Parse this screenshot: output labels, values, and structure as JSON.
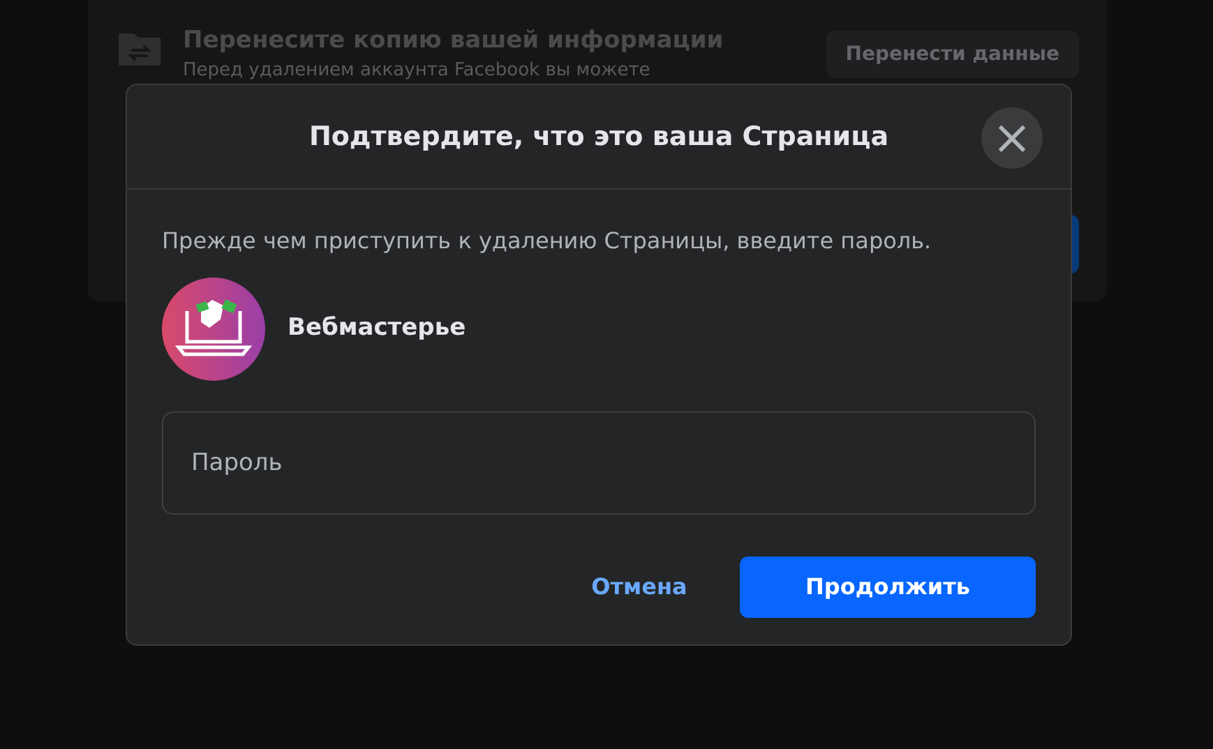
{
  "background_card": {
    "title": "Перенесите копию вашей информации",
    "subtitle": "Перед удалением аккаунта Facebook вы можете",
    "button": "Перенести данные"
  },
  "dialog": {
    "title": "Подтвердите, что это ваша Страница",
    "close": "×",
    "message": "Прежде чем приступить к удалению Страницы, введите пароль.",
    "page_name": "Вебмастерье",
    "password": {
      "placeholder": "Пароль"
    },
    "buttons": [
      {
        "label": "Отмена",
        "kind": "secondary"
      },
      {
        "label": "Продолжить",
        "kind": "primary"
      }
    ]
  }
}
